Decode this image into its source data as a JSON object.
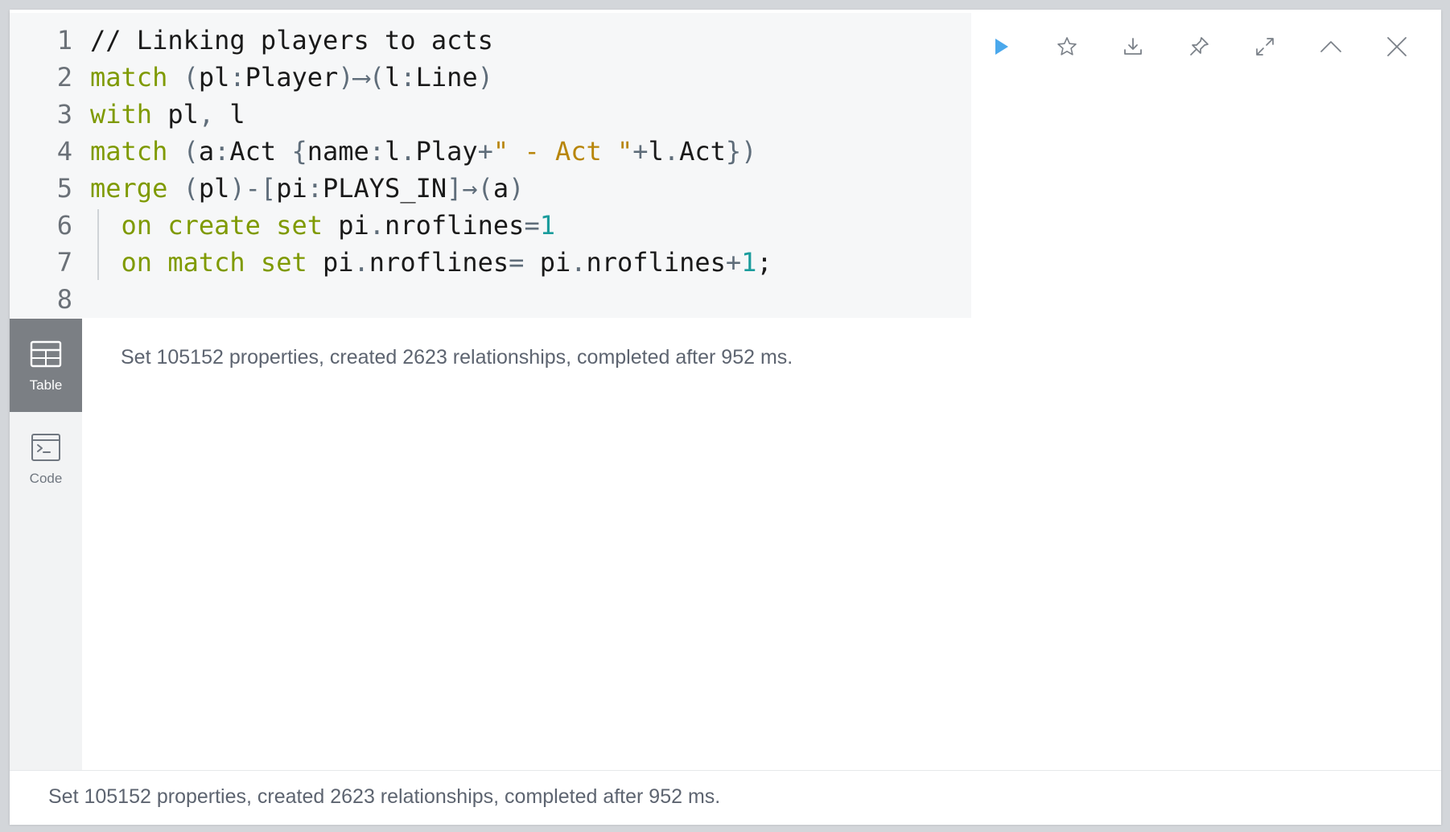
{
  "editor": {
    "lines": [
      {
        "num": "1",
        "tokens": [
          {
            "t": "// Linking players to acts",
            "c": "cm"
          }
        ]
      },
      {
        "num": "2",
        "tokens": [
          {
            "t": "match",
            "c": "kw"
          },
          {
            "t": " ",
            "c": "cm"
          },
          {
            "t": "(",
            "c": "pn"
          },
          {
            "t": "pl",
            "c": "cm"
          },
          {
            "t": ":",
            "c": "pn"
          },
          {
            "t": "Player",
            "c": "cm"
          },
          {
            "t": ")⟶(",
            "c": "pn"
          },
          {
            "t": "l",
            "c": "cm"
          },
          {
            "t": ":",
            "c": "pn"
          },
          {
            "t": "Line",
            "c": "cm"
          },
          {
            "t": ")",
            "c": "pn"
          }
        ]
      },
      {
        "num": "3",
        "tokens": [
          {
            "t": "with",
            "c": "kw"
          },
          {
            "t": " pl",
            "c": "cm"
          },
          {
            "t": ",",
            "c": "pn"
          },
          {
            "t": " l",
            "c": "cm"
          }
        ]
      },
      {
        "num": "4",
        "tokens": [
          {
            "t": "match",
            "c": "kw"
          },
          {
            "t": " ",
            "c": "cm"
          },
          {
            "t": "(",
            "c": "pn"
          },
          {
            "t": "a",
            "c": "cm"
          },
          {
            "t": ":",
            "c": "pn"
          },
          {
            "t": "Act ",
            "c": "cm"
          },
          {
            "t": "{",
            "c": "pn"
          },
          {
            "t": "name",
            "c": "cm"
          },
          {
            "t": ":",
            "c": "pn"
          },
          {
            "t": "l",
            "c": "cm"
          },
          {
            "t": ".",
            "c": "pn"
          },
          {
            "t": "Play",
            "c": "cm"
          },
          {
            "t": "+",
            "c": "pn"
          },
          {
            "t": "\" - Act \"",
            "c": "str"
          },
          {
            "t": "+",
            "c": "pn"
          },
          {
            "t": "l",
            "c": "cm"
          },
          {
            "t": ".",
            "c": "pn"
          },
          {
            "t": "Act",
            "c": "cm"
          },
          {
            "t": "})",
            "c": "pn"
          }
        ]
      },
      {
        "num": "5",
        "tokens": [
          {
            "t": "merge",
            "c": "kw"
          },
          {
            "t": " ",
            "c": "cm"
          },
          {
            "t": "(",
            "c": "pn"
          },
          {
            "t": "pl",
            "c": "cm"
          },
          {
            "t": ")-[",
            "c": "pn"
          },
          {
            "t": "pi",
            "c": "cm"
          },
          {
            "t": ":",
            "c": "pn"
          },
          {
            "t": "PLAYS_IN",
            "c": "cm"
          },
          {
            "t": "]→(",
            "c": "pn"
          },
          {
            "t": "a",
            "c": "cm"
          },
          {
            "t": ")",
            "c": "pn"
          }
        ]
      },
      {
        "num": "6",
        "tokens": [
          {
            "t": "  ",
            "c": "cm"
          },
          {
            "t": "on create set",
            "c": "kw"
          },
          {
            "t": " pi",
            "c": "cm"
          },
          {
            "t": ".",
            "c": "pn"
          },
          {
            "t": "nroflines",
            "c": "cm"
          },
          {
            "t": "=",
            "c": "pn"
          },
          {
            "t": "1",
            "c": "num"
          }
        ]
      },
      {
        "num": "7",
        "tokens": [
          {
            "t": "  ",
            "c": "cm"
          },
          {
            "t": "on match set",
            "c": "kw"
          },
          {
            "t": " pi",
            "c": "cm"
          },
          {
            "t": ".",
            "c": "pn"
          },
          {
            "t": "nroflines",
            "c": "cm"
          },
          {
            "t": "= ",
            "c": "pn"
          },
          {
            "t": "pi",
            "c": "cm"
          },
          {
            "t": ".",
            "c": "pn"
          },
          {
            "t": "nroflines",
            "c": "cm"
          },
          {
            "t": "+",
            "c": "pn"
          },
          {
            "t": "1",
            "c": "num"
          },
          {
            "t": ";",
            "c": "cm"
          }
        ]
      },
      {
        "num": "8",
        "tokens": []
      }
    ]
  },
  "toolbar": {
    "buttons": [
      {
        "name": "run-button",
        "icon": "play-icon"
      },
      {
        "name": "favorite-button",
        "icon": "star-icon"
      },
      {
        "name": "download-button",
        "icon": "download-icon"
      },
      {
        "name": "pin-button",
        "icon": "pin-icon"
      },
      {
        "name": "fullscreen-button",
        "icon": "expand-icon"
      },
      {
        "name": "collapse-button",
        "icon": "chevron-up-icon"
      },
      {
        "name": "close-button",
        "icon": "close-icon"
      }
    ]
  },
  "sidenav": {
    "table_label": "Table",
    "code_label": "Code"
  },
  "result": {
    "message": "Set 105152 properties, created 2623 relationships, completed after 952 ms."
  },
  "status": {
    "message": "Set 105152 properties, created 2623 relationships, completed after 952 ms."
  },
  "colors": {
    "play": "#4aa8ec",
    "icon": "#7a8088",
    "keyword": "#7f9a00",
    "string": "#b8860b",
    "number": "#1a9c9c"
  }
}
